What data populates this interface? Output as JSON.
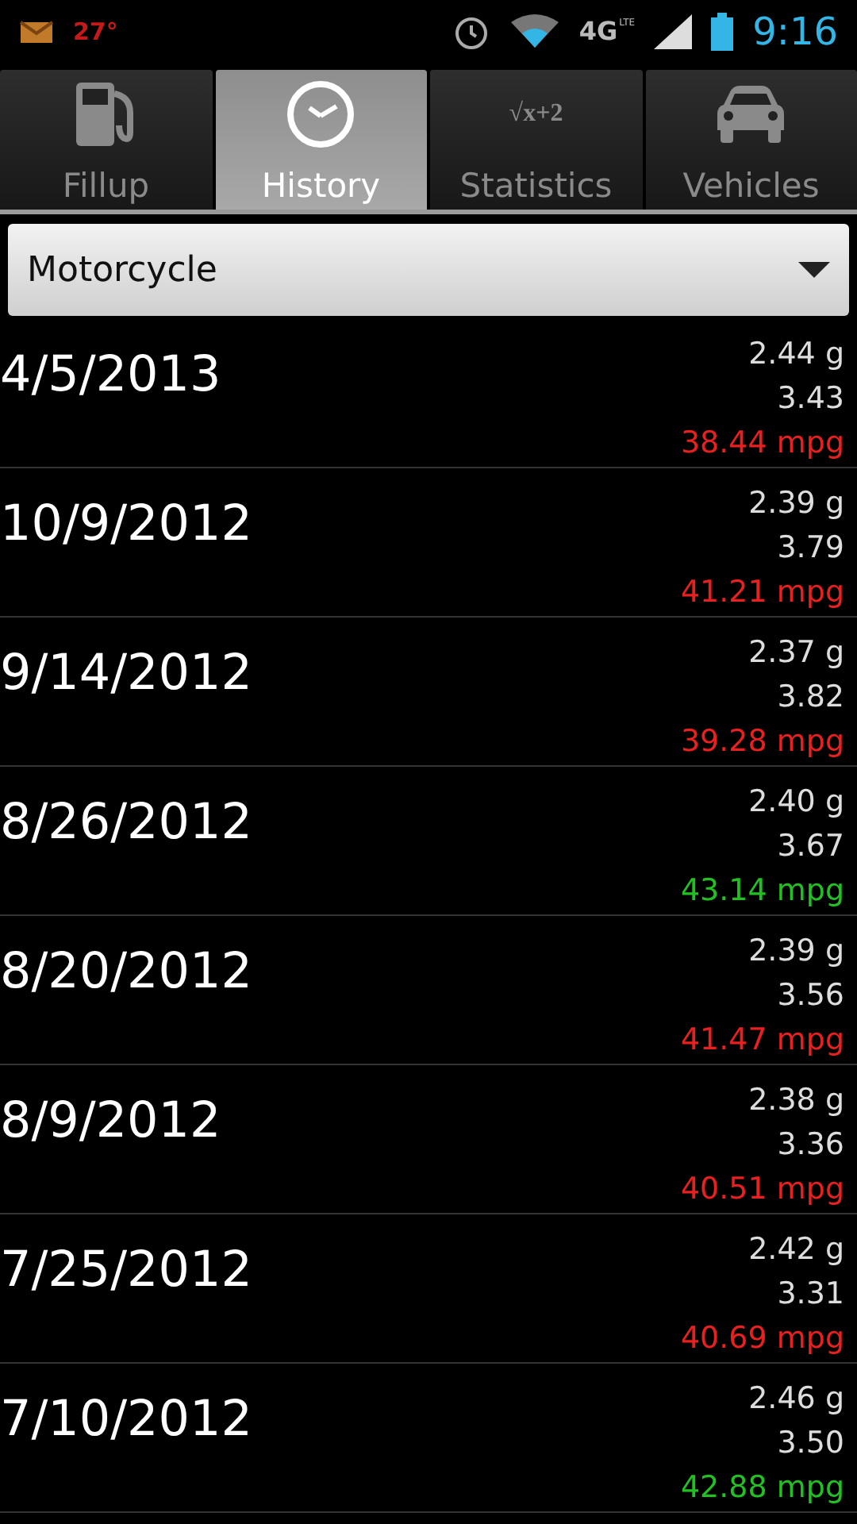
{
  "status_bar": {
    "temperature": "27°",
    "network": "4G",
    "network_sub": "LTE",
    "time": "9:16"
  },
  "tabs": [
    {
      "label": "Fillup",
      "kind": "pump",
      "selected": false
    },
    {
      "label": "History",
      "kind": "clock",
      "selected": true
    },
    {
      "label": "Statistics",
      "kind": "formula",
      "icon_text": "√x+2",
      "selected": false
    },
    {
      "label": "Vehicles",
      "kind": "car",
      "selected": false
    }
  ],
  "vehicle_select": {
    "value": "Motorcycle"
  },
  "entries": [
    {
      "date": "4/5/2013",
      "gallons": "2.44 g",
      "price": "3.43",
      "mpg": "38.44 mpg",
      "color": "#e82020"
    },
    {
      "date": "10/9/2012",
      "gallons": "2.39 g",
      "price": "3.79",
      "mpg": "41.21 mpg",
      "color": "#e82020"
    },
    {
      "date": "9/14/2012",
      "gallons": "2.37 g",
      "price": "3.82",
      "mpg": "39.28 mpg",
      "color": "#e82020"
    },
    {
      "date": "8/26/2012",
      "gallons": "2.40 g",
      "price": "3.67",
      "mpg": "43.14 mpg",
      "color": "#22c022"
    },
    {
      "date": "8/20/2012",
      "gallons": "2.39 g",
      "price": "3.56",
      "mpg": "41.47 mpg",
      "color": "#e82020"
    },
    {
      "date": "8/9/2012",
      "gallons": "2.38 g",
      "price": "3.36",
      "mpg": "40.51 mpg",
      "color": "#e82020"
    },
    {
      "date": "7/25/2012",
      "gallons": "2.42 g",
      "price": "3.31",
      "mpg": "40.69 mpg",
      "color": "#e82020"
    },
    {
      "date": "7/10/2012",
      "gallons": "2.46 g",
      "price": "3.50",
      "mpg": "42.88 mpg",
      "color": "#22c022"
    }
  ]
}
